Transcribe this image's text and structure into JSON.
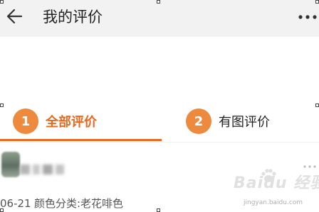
{
  "header": {
    "title": "我的评价",
    "back_icon": "arrow-left-icon",
    "more_icon": "more-horizontal-icon"
  },
  "tabs": [
    {
      "number": "1",
      "label": "全部评价",
      "active": true
    },
    {
      "number": "2",
      "label": "有图评价",
      "active": false
    }
  ],
  "review": {
    "date": "06-21",
    "spec": "颜色分类:老花啡色"
  },
  "watermark": {
    "logo_text": "Baidu 经验",
    "url": "jingyan.baidu.com"
  },
  "colors": {
    "accent": "#e8681d",
    "badge": "#ee8a3e",
    "header_bg": "#f2f2f2"
  }
}
